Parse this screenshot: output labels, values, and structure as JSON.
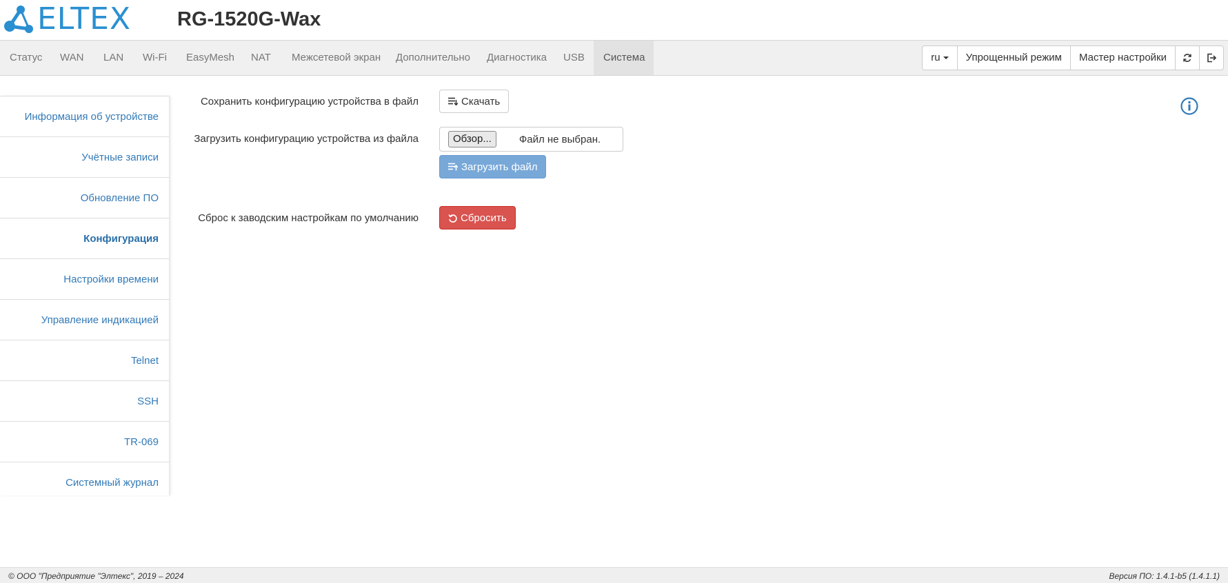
{
  "header": {
    "logo_text": "ELTEX",
    "model": "RG-1520G-Wax"
  },
  "nav": {
    "items": [
      {
        "label": "Статус"
      },
      {
        "label": "WAN"
      },
      {
        "label": "LAN"
      },
      {
        "label": "Wi-Fi"
      },
      {
        "label": "EasyMesh"
      },
      {
        "label": "NAT"
      },
      {
        "label": "Межсетевой экран"
      },
      {
        "label": "Дополнительно"
      },
      {
        "label": "Диагностика"
      },
      {
        "label": "USB"
      },
      {
        "label": "Система",
        "active": true
      }
    ],
    "lang": "ru",
    "simple_mode": "Упрощенный режим",
    "wizard": "Мастер настройки"
  },
  "sidebar": {
    "items": [
      {
        "label": "Информация об устройстве"
      },
      {
        "label": "Учётные записи"
      },
      {
        "label": "Обновление ПО"
      },
      {
        "label": "Конфигурация",
        "active": true
      },
      {
        "label": "Настройки времени"
      },
      {
        "label": "Управление индикацией"
      },
      {
        "label": "Telnet"
      },
      {
        "label": "SSH"
      },
      {
        "label": "TR-069"
      },
      {
        "label": "Системный журнал"
      }
    ]
  },
  "config": {
    "save_label": "Сохранить конфигурацию устройства в файл",
    "download_button": "Скачать",
    "load_label": "Загрузить конфигурацию устройства из файла",
    "browse_button": "Обзор...",
    "file_status": "Файл не выбран.",
    "upload_button": "Загрузить файл",
    "reset_label": "Сброс к заводским настройкам по умолчанию",
    "reset_button": "Сбросить"
  },
  "footer": {
    "copyright": "© ООО \"Предприятие \"Элтекс\", 2019 – 2024",
    "version": "Версия ПО: 1.4.1-b5 (1.4.1.1)"
  },
  "colors": {
    "accent": "#337ab7",
    "logo": "#2a8fd1",
    "danger": "#d9534f",
    "upload_disabled": "#77a8d8"
  }
}
